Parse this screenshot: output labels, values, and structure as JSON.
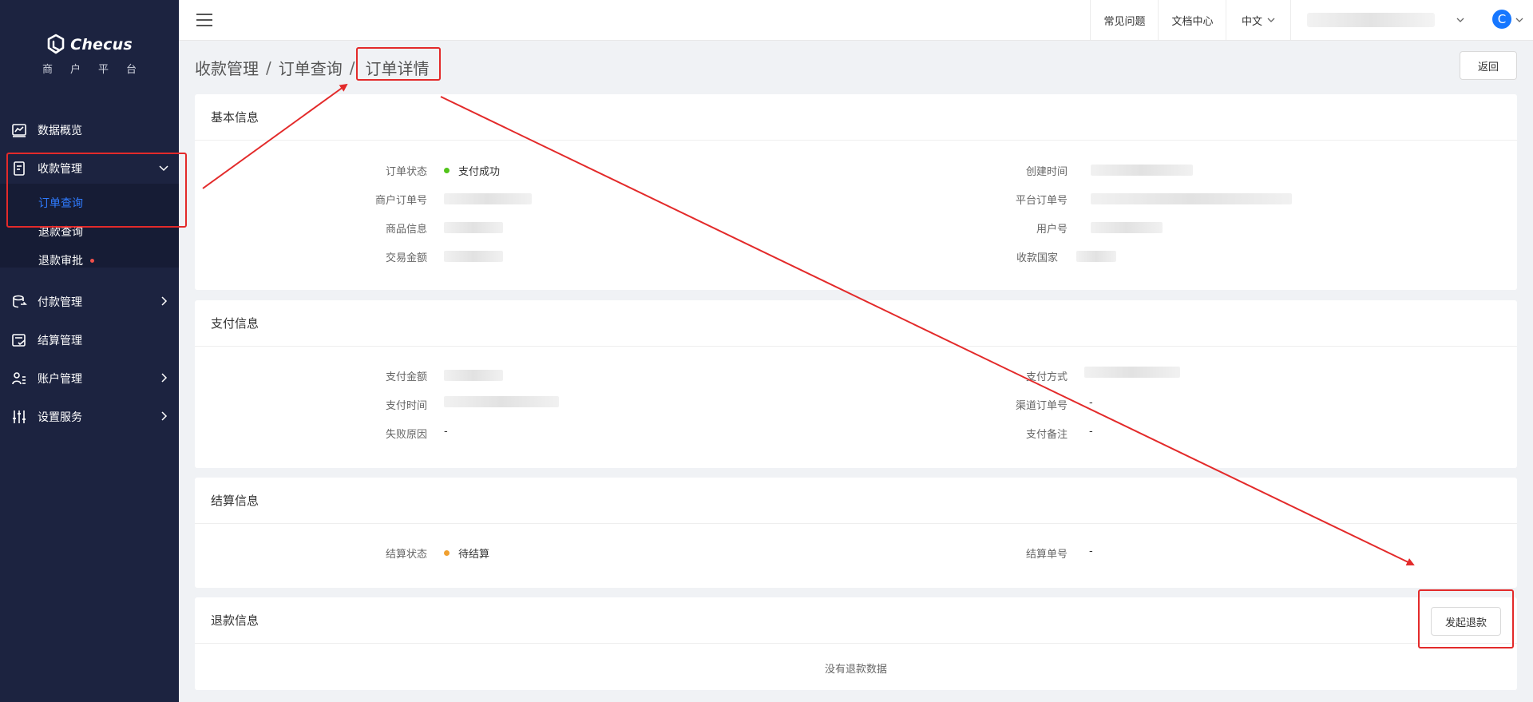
{
  "brand": {
    "name": "Checus",
    "subtitle": "商户平台"
  },
  "sidebar": {
    "items": [
      {
        "label": "数据概览",
        "icon": "chart-line-icon"
      },
      {
        "label": "收款管理",
        "icon": "receipt-icon",
        "expanded": true,
        "children": [
          {
            "label": "订单查询",
            "active": true
          },
          {
            "label": "退款查询"
          },
          {
            "label": "退款审批",
            "badge": "red-dot"
          }
        ]
      },
      {
        "label": "付款管理",
        "icon": "payment-out-icon"
      },
      {
        "label": "结算管理",
        "icon": "settlement-icon"
      },
      {
        "label": "账户管理",
        "icon": "account-icon"
      },
      {
        "label": "设置服务",
        "icon": "settings-sliders-icon"
      }
    ]
  },
  "topbar": {
    "faq": "常见问题",
    "docs": "文档中心",
    "language": "中文",
    "avatar_letter": "C"
  },
  "breadcrumb": [
    "收款管理",
    "订单查询",
    "订单详情"
  ],
  "back_button": "返回",
  "basic_info": {
    "title": "基本信息",
    "order_status_label": "订单状态",
    "order_status_value": "支付成功",
    "merchant_order_label": "商户订单号",
    "product_label": "商品信息",
    "amount_label": "交易金额",
    "created_label": "创建时间",
    "platform_order_label": "平台订单号",
    "user_label": "用户号",
    "country_label": "收款国家"
  },
  "payment_info": {
    "title": "支付信息",
    "pay_amount_label": "支付金额",
    "pay_time_label": "支付时间",
    "fail_reason_label": "失败原因",
    "fail_reason_value": "-",
    "pay_method_label": "支付方式",
    "channel_order_label": "渠道订单号",
    "channel_order_value": "-",
    "remark_label": "支付备注",
    "remark_value": "-"
  },
  "settlement_info": {
    "title": "结算信息",
    "status_label": "结算状态",
    "status_value": "待结算",
    "number_label": "结算单号",
    "number_value": "-"
  },
  "refund_info": {
    "title": "退款信息",
    "initiate_button": "发起退款",
    "empty": "没有退款数据"
  },
  "colors": {
    "sidebar_bg": "#1c2340",
    "active_link": "#2f7bff",
    "success": "#52c41a",
    "pending": "#faad14",
    "annotation": "#e32a2a"
  }
}
